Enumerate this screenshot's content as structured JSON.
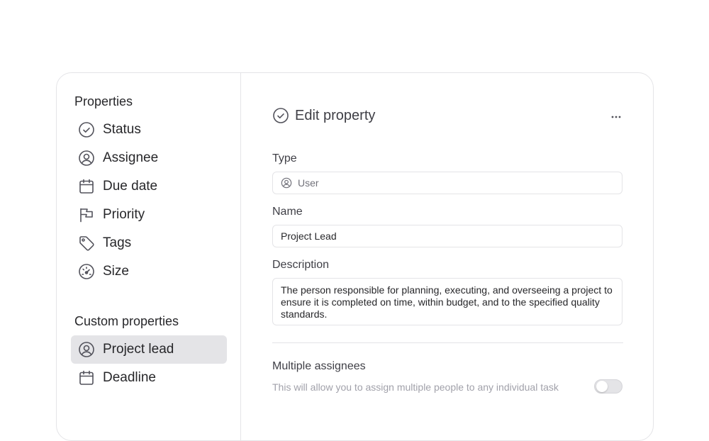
{
  "sidebar": {
    "properties_title": "Properties",
    "properties": [
      {
        "label": "Status",
        "icon": "check-circle-icon"
      },
      {
        "label": "Assignee",
        "icon": "user-circle-icon"
      },
      {
        "label": "Due date",
        "icon": "calendar-icon"
      },
      {
        "label": "Priority",
        "icon": "flag-icon"
      },
      {
        "label": "Tags",
        "icon": "tag-icon"
      },
      {
        "label": "Size",
        "icon": "gauge-icon"
      }
    ],
    "custom_title": "Custom properties",
    "custom": [
      {
        "label": "Project lead",
        "icon": "user-circle-icon",
        "active": true
      },
      {
        "label": "Deadline",
        "icon": "calendar-icon",
        "active": false
      }
    ]
  },
  "editor": {
    "title": "Edit property",
    "more_icon": "ellipsis-icon",
    "type_label": "Type",
    "type_value": "User",
    "name_label": "Name",
    "name_value": "Project Lead",
    "description_label": "Description",
    "description_value": "The person responsible for planning, executing, and overseeing a project to ensure it is completed on time, within budget, and to the specified quality standards.",
    "multiple_label": "Multiple assignees",
    "multiple_help": "This will allow you to assign multiple people to any individual task",
    "multiple_enabled": false
  }
}
